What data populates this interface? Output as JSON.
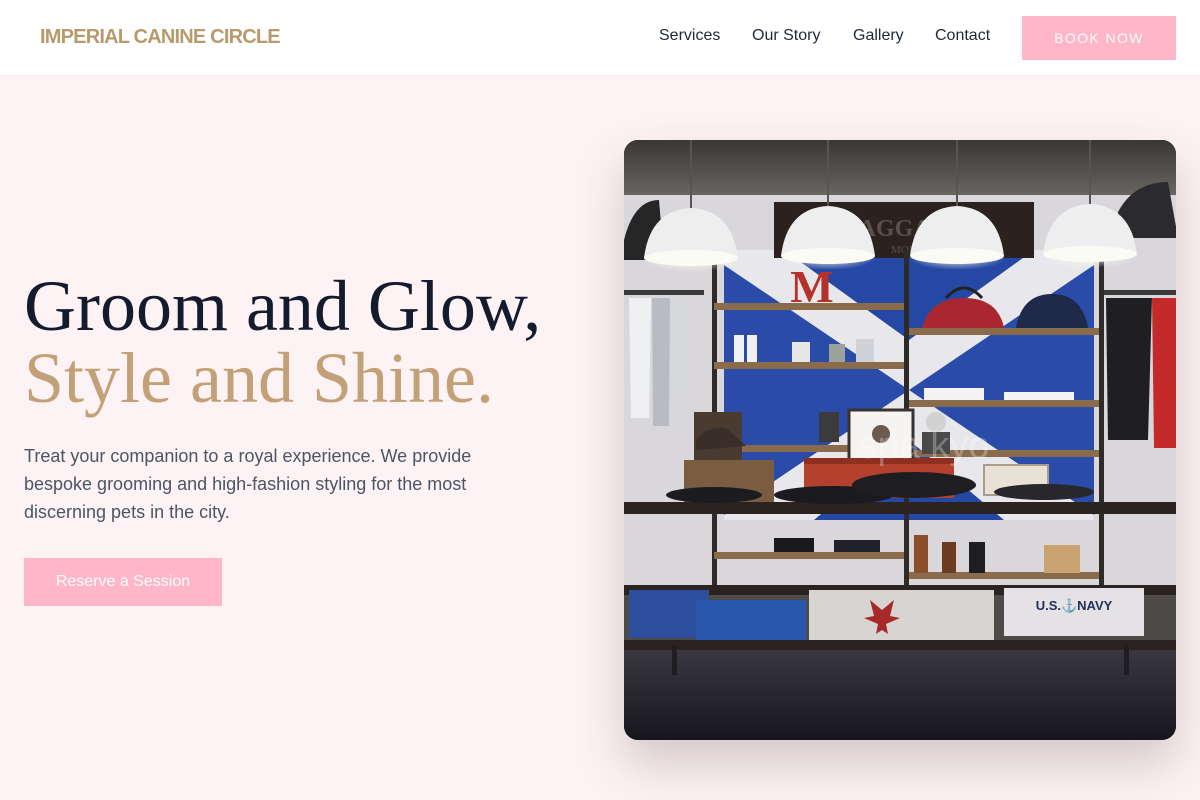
{
  "brand": {
    "name": "IMPERIAL CANINE CIRCLE",
    "color": "#b89a6c"
  },
  "nav": {
    "items": [
      {
        "label": "Services"
      },
      {
        "label": "Our Story"
      },
      {
        "label": "Gallery"
      },
      {
        "label": "Contact"
      }
    ],
    "cta_label": "BOOK NOW"
  },
  "hero": {
    "headline_line1": "Groom and Glow,",
    "headline_line2": "Style and Shine.",
    "description": "Treat your companion to a royal experience. We provide bespoke grooming and high-fashion styling for the most discerning pets in the city.",
    "cta_label": "Reserve a Session"
  },
  "image": {
    "alt": "Clothing boutique interior",
    "signs": {
      "letter": "M",
      "banner": "BAGGAGE",
      "banner_sub": "MON",
      "shirt": "U.S.⚓NAVY",
      "watermark": "spa  kyo"
    }
  },
  "colors": {
    "accent_pink": "#ffb6c9",
    "gold": "#c2a178",
    "ink": "#141b2d",
    "background": "#fdf3f4"
  },
  "icons": [
    "lamp-icon"
  ]
}
